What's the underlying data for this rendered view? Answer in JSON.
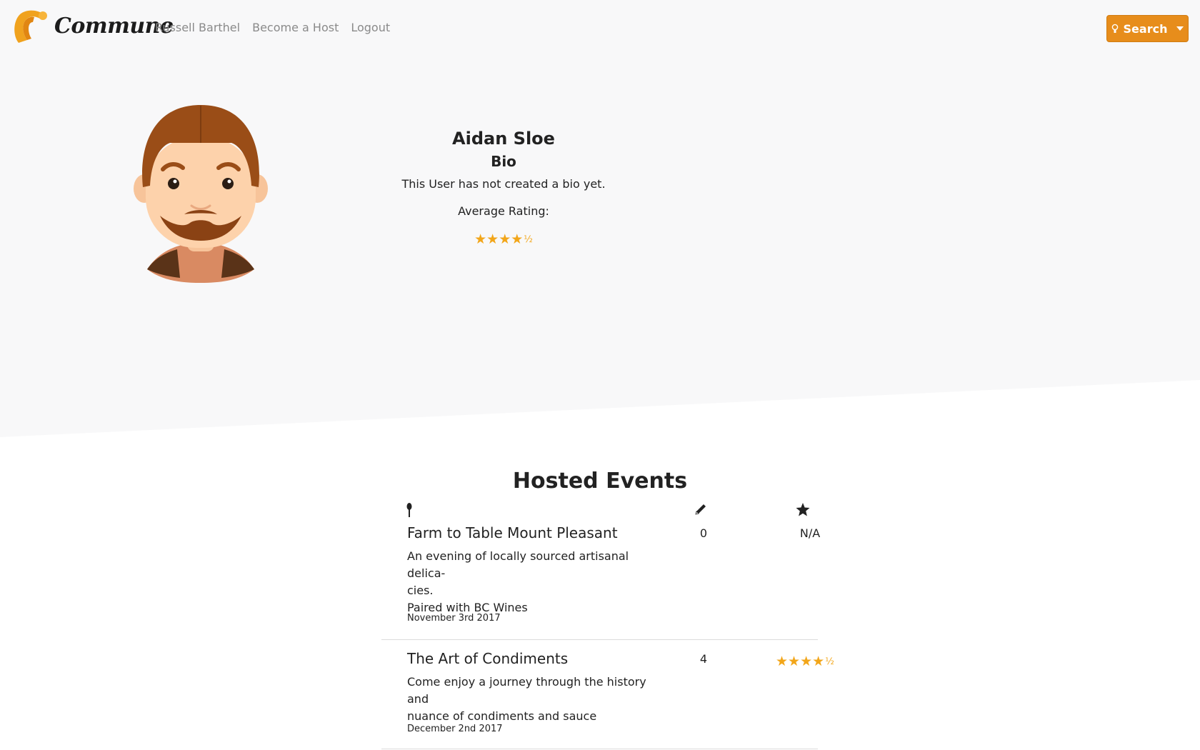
{
  "nav": {
    "brand": "Commune",
    "links": [
      "Russell Barthel",
      "Become a Host",
      "Logout"
    ],
    "search_label": "Search",
    "accent": "#e78d1b"
  },
  "profile": {
    "name": "Aidan Sloe",
    "bio_heading": "Bio",
    "bio_text": "This User has not created a bio yet.",
    "rating_label": "Average Rating:",
    "rating": 4.5
  },
  "events": {
    "title": "Hosted Events",
    "column_icons": [
      "spoon-icon",
      "pencil-icon",
      "star-icon"
    ],
    "items": [
      {
        "title": "Farm to Table Mount Pleasant",
        "description": "An evening of locally sourced artisanal delica-\ncies.\n Paired with BC Wines",
        "date": "November 3rd 2017",
        "count": "0",
        "rating": "N/A"
      },
      {
        "title": "The Art of Condiments",
        "description": "Come enjoy a journey through the history and\nnuance of condiments and sauce",
        "date": "December 2nd 2017",
        "count": "4",
        "rating": 4.5
      }
    ]
  },
  "colors": {
    "star": "#f2a61a",
    "hero_bg": "#f8f8f9"
  }
}
